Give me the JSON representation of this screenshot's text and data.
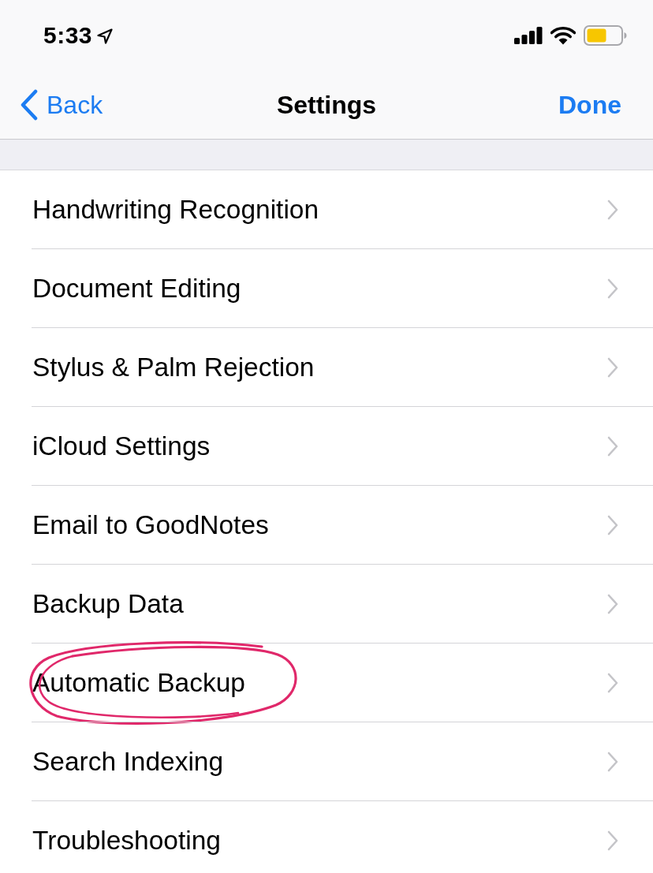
{
  "status_bar": {
    "time": "5:33"
  },
  "nav_bar": {
    "back": "Back",
    "title": "Settings",
    "done": "Done"
  },
  "items": [
    {
      "label": "Handwriting Recognition",
      "circled": false
    },
    {
      "label": "Document Editing",
      "circled": false
    },
    {
      "label": "Stylus & Palm Rejection",
      "circled": false
    },
    {
      "label": "iCloud Settings",
      "circled": false
    },
    {
      "label": "Email to GoodNotes",
      "circled": false
    },
    {
      "label": "Backup Data",
      "circled": false
    },
    {
      "label": "Automatic Backup",
      "circled": true
    },
    {
      "label": "Search Indexing",
      "circled": false
    },
    {
      "label": "Troubleshooting",
      "circled": false
    }
  ]
}
